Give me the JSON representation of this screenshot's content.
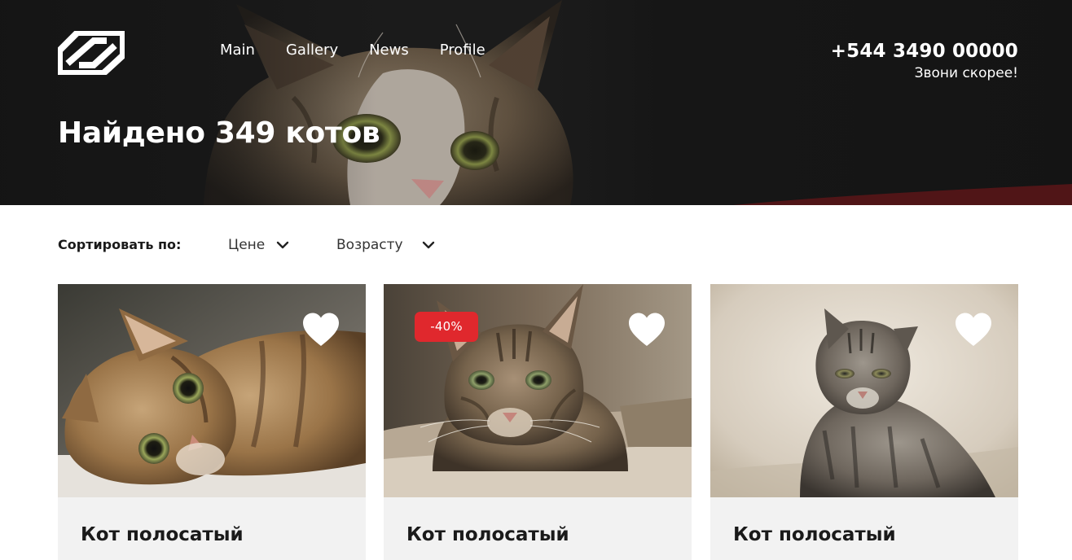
{
  "nav": {
    "items": [
      {
        "label": "Main"
      },
      {
        "label": "Gallery"
      },
      {
        "label": "News"
      },
      {
        "label": "Profile"
      }
    ]
  },
  "contact": {
    "phone": "+544 3490 00000",
    "tagline": "Звони скорее!"
  },
  "hero": {
    "title": "Найдено 349 котов"
  },
  "sort": {
    "label": "Сортировать по:",
    "options": [
      {
        "label": "Цене",
        "icon": "chevron-down-icon"
      },
      {
        "label": "Возрасту",
        "icon": "chevron-down-icon"
      }
    ]
  },
  "cards": [
    {
      "title": "Кот полосатый",
      "badge": "",
      "icon": "heart-icon"
    },
    {
      "title": "Кот полосатый",
      "badge": "-40%",
      "icon": "heart-icon"
    },
    {
      "title": "Кот полосатый",
      "badge": "",
      "icon": "heart-icon"
    }
  ],
  "colors": {
    "accent": "#e0282d",
    "hero_bg": "#1b1b1b",
    "card_bg": "#f2f2f2",
    "text": "#1a1a1a"
  }
}
